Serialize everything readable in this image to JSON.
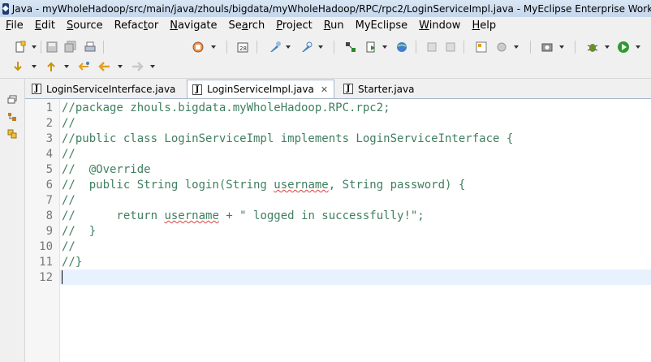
{
  "window": {
    "title": "Java - myWholeHadoop/src/main/java/zhouls/bigdata/myWholeHadoop/RPC/rpc2/LoginServiceImpl.java - MyEclipse Enterprise Workb"
  },
  "menu": {
    "items": [
      {
        "mnemonic": "F",
        "rest": "ile"
      },
      {
        "mnemonic": "E",
        "rest": "dit"
      },
      {
        "mnemonic": "S",
        "rest": "ource"
      },
      {
        "mnemonic": "",
        "rest": "Refac",
        "mnemonic2": "t",
        "rest2": "or"
      },
      {
        "mnemonic": "N",
        "rest": "avigate"
      },
      {
        "mnemonic": "",
        "rest": "Se",
        "mnemonic2": "a",
        "rest2": "rch"
      },
      {
        "mnemonic": "P",
        "rest": "roject"
      },
      {
        "mnemonic": "R",
        "rest": "un"
      },
      {
        "mnemonic": "",
        "rest": "MyEclipse"
      },
      {
        "mnemonic": "W",
        "rest": "indow"
      },
      {
        "mnemonic": "H",
        "rest": "elp"
      }
    ]
  },
  "tabs": [
    {
      "label": "LoginServiceInterface.java",
      "active": false
    },
    {
      "label": "LoginServiceImpl.java",
      "active": true,
      "close": "✕"
    },
    {
      "label": "Starter.java",
      "active": false
    }
  ],
  "editor": {
    "lines": [
      {
        "n": "1",
        "text": "//package zhouls.bigdata.myWholeHadoop.RPC.rpc2;"
      },
      {
        "n": "2",
        "text": "//"
      },
      {
        "n": "3",
        "text": "//public class LoginServiceImpl implements LoginServiceInterface {"
      },
      {
        "n": "4",
        "text": "//"
      },
      {
        "n": "5",
        "text": "//  @Override"
      },
      {
        "n": "6",
        "pre": "//  public String login(String ",
        "sq": "username",
        "post": ", String password) {"
      },
      {
        "n": "7",
        "text": "//"
      },
      {
        "n": "8",
        "pre": "//      return ",
        "sq": "username",
        "post": " + \" logged in successfully!\";"
      },
      {
        "n": "9",
        "text": "//  }"
      },
      {
        "n": "10",
        "text": "//"
      },
      {
        "n": "11",
        "text": "//}"
      },
      {
        "n": "12",
        "text": ""
      }
    ]
  },
  "colors": {
    "comment": "#3f7f5f",
    "line_number": "#787878",
    "current_line": "#e8f2fe"
  },
  "toolbar": {
    "icons": [
      "new-icon",
      "save-icon",
      "save-all-icon",
      "print-icon",
      "new-server-icon",
      "open-type-icon",
      "web-service-icon",
      "open-icon",
      "deploy-icon",
      "run-server-icon",
      "browser-icon",
      "back-icon",
      "forward-icon",
      "db-icon",
      "settings-icon",
      "camera-icon",
      "debug-icon",
      "run-icon",
      "external-tools-icon",
      "next-annotation-icon",
      "prev-annotation-icon",
      "last-edit-icon",
      "nav-back-icon",
      "nav-forward-icon"
    ]
  }
}
